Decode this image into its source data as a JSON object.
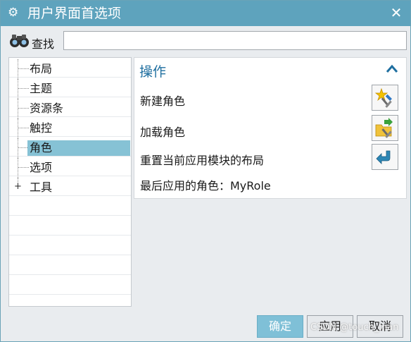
{
  "window": {
    "title": "用户界面首选项",
    "title_icon": "gear-icon",
    "close_symbol": "✕"
  },
  "search": {
    "label": "查找",
    "icon": "binoculars-icon",
    "value": ""
  },
  "tree": {
    "items": [
      {
        "label": "布局"
      },
      {
        "label": "主题"
      },
      {
        "label": "资源条"
      },
      {
        "label": "触控"
      },
      {
        "label": "角色",
        "selected": true
      },
      {
        "label": "选项"
      },
      {
        "label": "工具",
        "expander": "+"
      }
    ]
  },
  "panel": {
    "section_title": "操作",
    "collapse_icon": "chevron-up-icon",
    "ops": [
      {
        "label": "新建角色",
        "icon": "new-role-icon"
      },
      {
        "label": "加载角色",
        "icon": "load-role-icon"
      },
      {
        "label": "重置当前应用模块的布局",
        "icon": "reset-layout-icon"
      }
    ],
    "last_role": "最后应用的角色：MyRole"
  },
  "footer": {
    "ok_label": "确定",
    "apply_label": "应用",
    "cancel_label": "取消"
  },
  "watermark": "CSDN @touch_inan",
  "colors": {
    "titlebar": "#5ea3bd",
    "selection": "#86c2d5",
    "section_title": "#1f6fa0",
    "primary_button": "#7fc0d7"
  }
}
